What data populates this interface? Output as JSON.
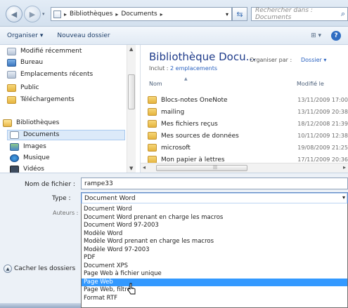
{
  "address": {
    "path": [
      "Bibliothèques",
      "Documents"
    ],
    "search_placeholder": "Rechercher dans : Documents"
  },
  "toolbar": {
    "organize": "Organiser ▾",
    "new_folder": "Nouveau dossier",
    "views": "⊞ ▾",
    "help": "?"
  },
  "nav": {
    "items": [
      {
        "label": "Modifié récemment",
        "icon": "gray"
      },
      {
        "label": "Bureau",
        "icon": "blue"
      },
      {
        "label": "Emplacements récents",
        "icon": "gray"
      },
      {
        "label": "Public",
        "icon": "folder"
      },
      {
        "label": "Téléchargements",
        "icon": "folder"
      },
      {
        "label": "Bibliothèques",
        "icon": "lib"
      },
      {
        "label": "Documents",
        "icon": "doc"
      },
      {
        "label": "Images",
        "icon": "img"
      },
      {
        "label": "Musique",
        "icon": "music"
      },
      {
        "label": "Vidéos",
        "icon": "video"
      }
    ]
  },
  "library": {
    "title": "Bibliothèque Docu...",
    "includes_label": "Inclut :",
    "includes_link": "2 emplacements",
    "arrange_label": "Organiser par :",
    "arrange_value": "Dossier ▾",
    "col_name": "Nom",
    "col_modified": "Modifié le"
  },
  "files": [
    {
      "name": "Blocs-notes OneNote",
      "date": "13/11/2009 17:00"
    },
    {
      "name": "mailing",
      "date": "13/11/2009 20:38"
    },
    {
      "name": "Mes fichiers reçus",
      "date": "18/12/2008 21:39"
    },
    {
      "name": "Mes sources de données",
      "date": "10/11/2009 12:38"
    },
    {
      "name": "microsoft",
      "date": "19/08/2009 21:25"
    },
    {
      "name": "Mon papier à lettres",
      "date": "17/11/2009 20:36"
    }
  ],
  "form": {
    "filename_label": "Nom de fichier :",
    "filename_value": "rampe33",
    "type_label": "Type :",
    "type_value": "Document Word",
    "authors_label": "Auteurs :",
    "hide_folders": "Cacher les dossiers"
  },
  "type_options": [
    "Document Word",
    "Document Word prenant en charge les macros",
    "Document Word 97-2003",
    "Modèle Word",
    "Modèle Word prenant en charge les macros",
    "Modèle Word 97-2003",
    "PDF",
    "Document XPS",
    "Page Web à fichier unique",
    "Page Web",
    "Page Web, filtrée",
    "Format RTF"
  ],
  "selected_type_index": 9
}
